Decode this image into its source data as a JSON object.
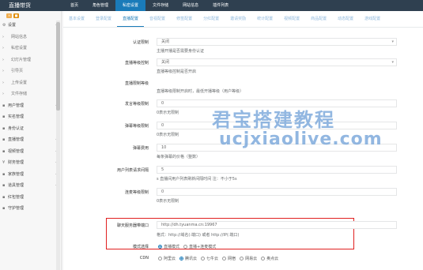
{
  "app": {
    "brand": "直播带货"
  },
  "topnav": [
    "首页",
    "角色管理",
    "私密设置",
    "文件存储",
    "网站信息",
    "插件列表"
  ],
  "topnav_active": 2,
  "sidebar": {
    "buttons": [
      "×",
      "■"
    ],
    "items": [
      {
        "label": "设置",
        "lead": "⚙",
        "arrow": "‹",
        "type": "cat"
      },
      {
        "label": "网站信息",
        "lead": "›",
        "arrow": "",
        "type": "sub"
      },
      {
        "label": "私密设置",
        "lead": "›",
        "arrow": "",
        "type": "sub"
      },
      {
        "label": "幻灯片管理",
        "lead": "›",
        "arrow": "",
        "type": "sub"
      },
      {
        "label": "引导页",
        "lead": "›",
        "arrow": "",
        "type": "sub"
      },
      {
        "label": "上传设置",
        "lead": "›",
        "arrow": "",
        "type": "sub"
      },
      {
        "label": "文件存储",
        "lead": "›",
        "arrow": "",
        "type": "sub"
      },
      {
        "label": "用户管理",
        "lead": "▪",
        "arrow": "‹",
        "type": "cat"
      },
      {
        "label": "实名管理",
        "lead": "▪",
        "arrow": "",
        "type": "cat"
      },
      {
        "label": "身份认证",
        "lead": "▪",
        "arrow": "",
        "type": "cat"
      },
      {
        "label": "直播管理",
        "lead": "▪",
        "arrow": "‹",
        "type": "cat"
      },
      {
        "label": "视频管理",
        "lead": "▪",
        "arrow": "‹",
        "type": "cat"
      },
      {
        "label": "财务管理",
        "lead": "¥",
        "arrow": "‹",
        "type": "cat"
      },
      {
        "label": "家族管理",
        "lead": "▪",
        "arrow": "‹",
        "type": "cat"
      },
      {
        "label": "道具管理",
        "lead": "▪",
        "arrow": "‹",
        "type": "cat"
      },
      {
        "label": "红包管理",
        "lead": "▪",
        "arrow": "",
        "type": "cat"
      },
      {
        "label": "守护管理",
        "lead": "▪",
        "arrow": "",
        "type": "cat"
      }
    ]
  },
  "tabs": [
    "基本设置",
    "登录配置",
    "直播配置",
    "音视配置",
    "修签配置",
    "分红配置",
    "邀请奖励",
    "统计配置",
    "视频配置",
    "商品配置",
    "动态配置",
    "游戏配置"
  ],
  "tabs_active": 2,
  "form": {
    "auth_label": "认证限制",
    "auth_value": "关闭",
    "auth_help": "主播开播是否需要身份认证",
    "level_ctl_label": "直播等级控制",
    "level_ctl_value": "关闭",
    "level_ctl_help": "直播等级控制是否开启",
    "level_limit_label": "直播限制等级",
    "level_limit_help": "直播等级限制开启时，最低开播等级（用户等级）",
    "friend_label": "发言等级限制",
    "friend_value": "0",
    "friend_help": "0表示无限制",
    "danmu_level_label": "弹幕等级限制",
    "danmu_level_value": "0",
    "danmu_level_help": "0表示无限制",
    "danmu_fee_label": "弹幕费用",
    "danmu_fee_value": "10",
    "danmu_fee_help": "每条弹幕的价格（整数）",
    "interval_label": "用户列表请求间隔",
    "interval_value": "5",
    "interval_help": "s 直播间用户列表刷新间隔时间 注：不小于5s",
    "mic_label": "连麦等级限制",
    "mic_value": "0",
    "mic_help": "0表示无限制",
    "chat_label": "聊天服务器带端口",
    "chat_value": "http://dh.tyuanma.cn:19967",
    "chat_help": "格式：http://域名(:端口) 或者 http://IP(:端口)",
    "mode_label": "模式选择",
    "mode_options": [
      "直播模式",
      "直播+连麦模式"
    ],
    "mode_selected": 0,
    "cdn_label": "CDN",
    "cdn_options": [
      "阿里云",
      "腾讯云",
      "七牛云",
      "网宿",
      "网易云",
      "奥点云"
    ],
    "cdn_selected": 1
  },
  "watermark": {
    "cn": "君宝搭建教程",
    "en": "ucjxiaolive.com"
  },
  "colors": {
    "topbar": "#2f4050",
    "accent": "#1a7bb9",
    "highlight": "#e02020",
    "watermark": "#6ea0d8"
  }
}
